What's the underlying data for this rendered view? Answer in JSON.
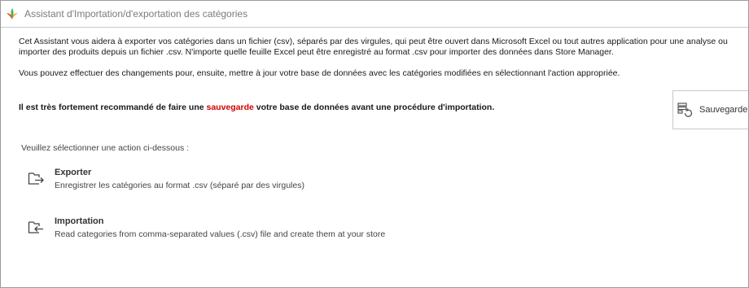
{
  "window": {
    "title": "Assistant d'Importation/d'exportation des catégories"
  },
  "intro": {
    "line1": "Cet Assistant vous aidera à exporter vos catégories dans un fichier (csv), séparés par des virgules, qui peut être ouvert dans Microsoft Excel ou tout autres application pour une analyse ou",
    "line2": "importer des produits depuis un fichier .csv. N'importe quelle feuille Excel peut être enregistré au format .csv pour importer des données dans Store Manager.",
    "line3": "Vous pouvez effectuer des changements pour, ensuite, mettre à jour votre base de données avec les catégories modifiées en sélectionnant l'action appropriée."
  },
  "warning": {
    "before": "Il est très fortement recommandé de faire une ",
    "highlight": "sauvegarde",
    "after": " votre base de données avant une procédure d'importation.",
    "highlight_color": "#d40000"
  },
  "backup_button": {
    "label": "Sauvegarde"
  },
  "actions": {
    "prompt": "Veuillez sélectionner une action ci-dessous :",
    "items": [
      {
        "title": "Exporter",
        "description": "Enregistrer les catégories au format .csv (séparé par des virgules)",
        "icon": "folder-export-icon"
      },
      {
        "title": "Importation",
        "description": "Read categories from comma-separated values (.csv) file and create them at your store",
        "icon": "folder-import-icon"
      }
    ]
  }
}
